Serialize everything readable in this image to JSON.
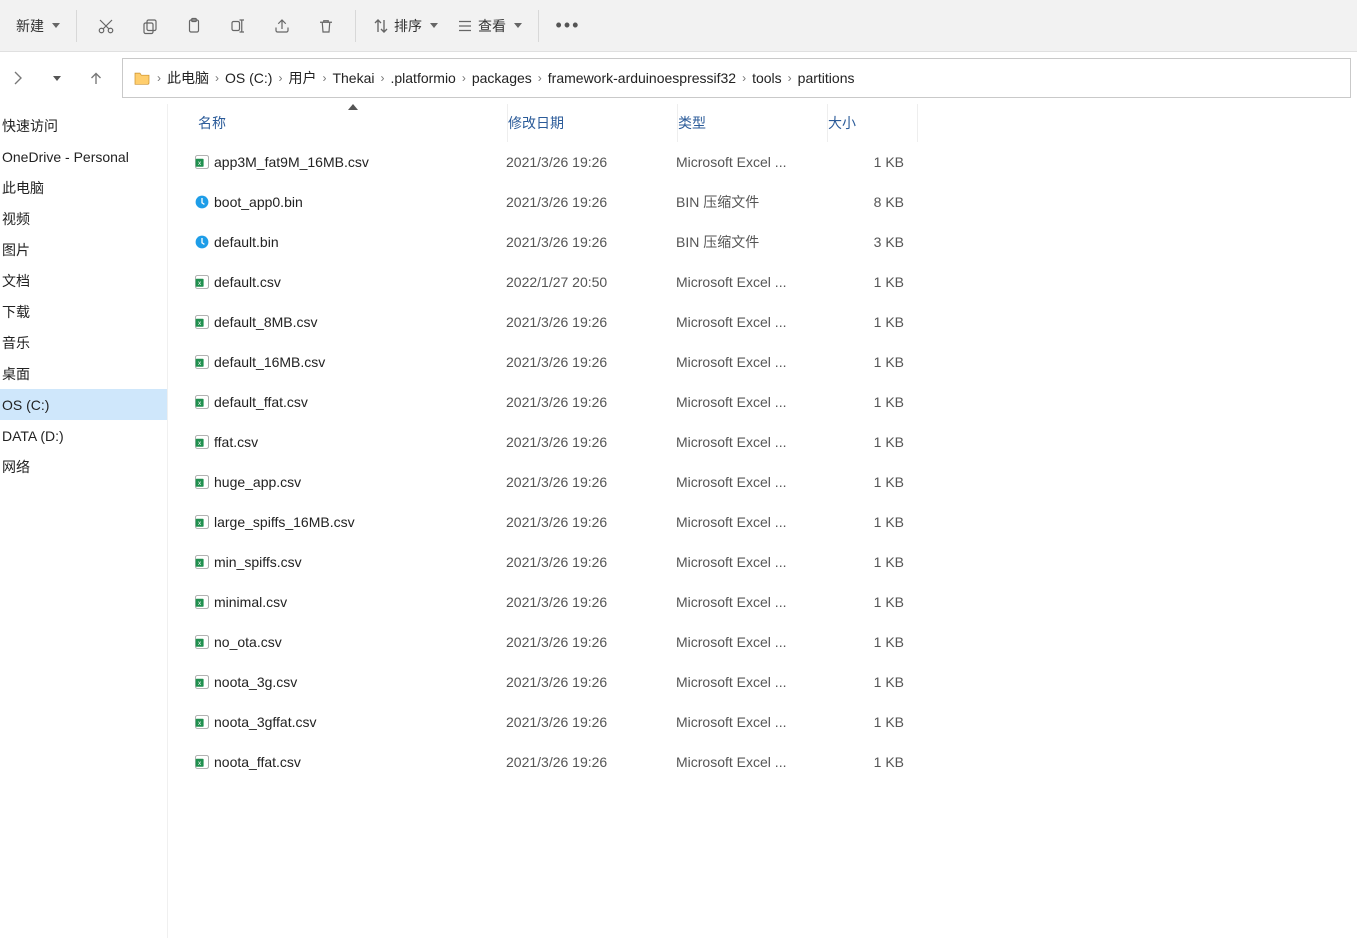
{
  "toolbar": {
    "new_label": "新建",
    "sort_label": "排序",
    "view_label": "查看"
  },
  "breadcrumb": {
    "segments": [
      "此电脑",
      "OS (C:)",
      "用户",
      "Thekai",
      ".platformio",
      "packages",
      "framework-arduinoespressif32",
      "tools",
      "partitions"
    ]
  },
  "sidebar": {
    "items": [
      {
        "label": "快速访问",
        "selected": false
      },
      {
        "label": "OneDrive - Personal",
        "selected": false
      },
      {
        "label": "此电脑",
        "selected": false
      },
      {
        "label": "视频",
        "selected": false
      },
      {
        "label": "图片",
        "selected": false
      },
      {
        "label": "文档",
        "selected": false
      },
      {
        "label": "下载",
        "selected": false
      },
      {
        "label": "音乐",
        "selected": false
      },
      {
        "label": "桌面",
        "selected": false
      },
      {
        "label": "OS (C:)",
        "selected": true
      },
      {
        "label": "DATA (D:)",
        "selected": false
      },
      {
        "label": "网络",
        "selected": false
      }
    ]
  },
  "columns": {
    "name": "名称",
    "date": "修改日期",
    "type": "类型",
    "size": "大小",
    "sorted_on": "name",
    "sort_dir": "asc"
  },
  "files": [
    {
      "icon": "excel",
      "name": "app3M_fat9M_16MB.csv",
      "date": "2021/3/26 19:26",
      "type": "Microsoft Excel ...",
      "size": "1 KB"
    },
    {
      "icon": "bin",
      "name": "boot_app0.bin",
      "date": "2021/3/26 19:26",
      "type": "BIN 压缩文件",
      "size": "8 KB"
    },
    {
      "icon": "bin",
      "name": "default.bin",
      "date": "2021/3/26 19:26",
      "type": "BIN 压缩文件",
      "size": "3 KB"
    },
    {
      "icon": "excel",
      "name": "default.csv",
      "date": "2022/1/27 20:50",
      "type": "Microsoft Excel ...",
      "size": "1 KB"
    },
    {
      "icon": "excel",
      "name": "default_8MB.csv",
      "date": "2021/3/26 19:26",
      "type": "Microsoft Excel ...",
      "size": "1 KB"
    },
    {
      "icon": "excel",
      "name": "default_16MB.csv",
      "date": "2021/3/26 19:26",
      "type": "Microsoft Excel ...",
      "size": "1 KB"
    },
    {
      "icon": "excel",
      "name": "default_ffat.csv",
      "date": "2021/3/26 19:26",
      "type": "Microsoft Excel ...",
      "size": "1 KB"
    },
    {
      "icon": "excel",
      "name": "ffat.csv",
      "date": "2021/3/26 19:26",
      "type": "Microsoft Excel ...",
      "size": "1 KB"
    },
    {
      "icon": "excel",
      "name": "huge_app.csv",
      "date": "2021/3/26 19:26",
      "type": "Microsoft Excel ...",
      "size": "1 KB"
    },
    {
      "icon": "excel",
      "name": "large_spiffs_16MB.csv",
      "date": "2021/3/26 19:26",
      "type": "Microsoft Excel ...",
      "size": "1 KB"
    },
    {
      "icon": "excel",
      "name": "min_spiffs.csv",
      "date": "2021/3/26 19:26",
      "type": "Microsoft Excel ...",
      "size": "1 KB"
    },
    {
      "icon": "excel",
      "name": "minimal.csv",
      "date": "2021/3/26 19:26",
      "type": "Microsoft Excel ...",
      "size": "1 KB"
    },
    {
      "icon": "excel",
      "name": "no_ota.csv",
      "date": "2021/3/26 19:26",
      "type": "Microsoft Excel ...",
      "size": "1 KB"
    },
    {
      "icon": "excel",
      "name": "noota_3g.csv",
      "date": "2021/3/26 19:26",
      "type": "Microsoft Excel ...",
      "size": "1 KB"
    },
    {
      "icon": "excel",
      "name": "noota_3gffat.csv",
      "date": "2021/3/26 19:26",
      "type": "Microsoft Excel ...",
      "size": "1 KB"
    },
    {
      "icon": "excel",
      "name": "noota_ffat.csv",
      "date": "2021/3/26 19:26",
      "type": "Microsoft Excel ...",
      "size": "1 KB"
    }
  ]
}
